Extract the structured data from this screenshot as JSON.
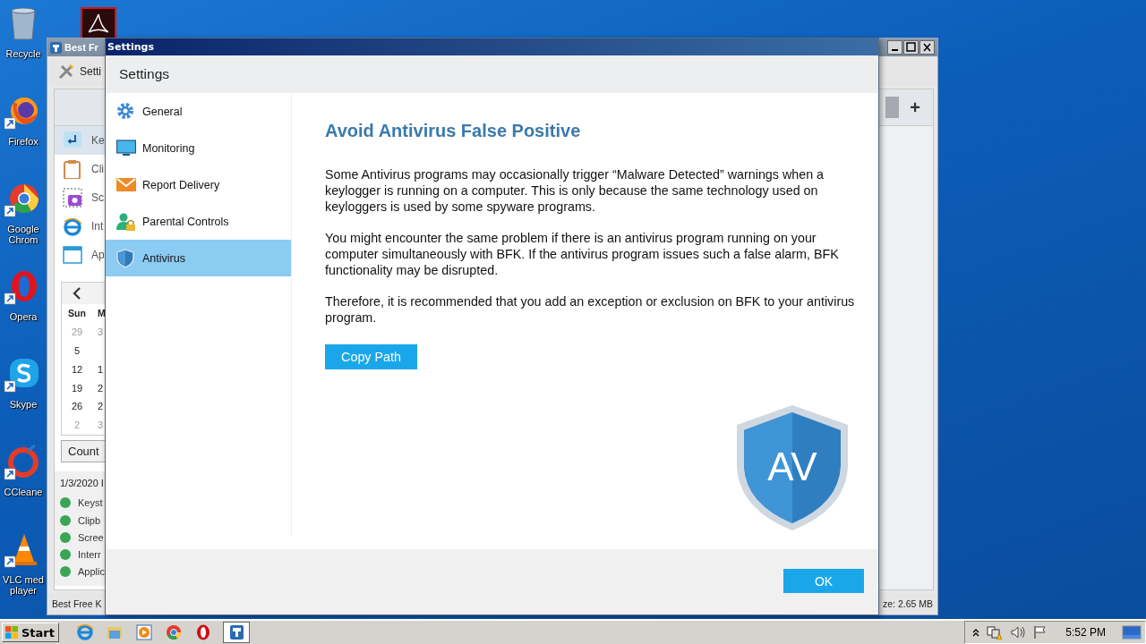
{
  "desktop_icons": [
    {
      "kind": "recycle",
      "label": "Recycle"
    },
    {
      "kind": "firefox",
      "label": "Firefox"
    },
    {
      "kind": "chrome",
      "label": "Google Chrom"
    },
    {
      "kind": "opera",
      "label": "Opera"
    },
    {
      "kind": "skype",
      "label": "Skype"
    },
    {
      "kind": "ccleaner",
      "label": "CCleane"
    },
    {
      "kind": "vlc",
      "label": "VLC med player"
    }
  ],
  "background_window": {
    "title": "Best Fr",
    "toolbar_button": "Setti",
    "sidebar_items": [
      {
        "kind": "keys",
        "label": "Ke",
        "selected": true
      },
      {
        "kind": "clipboard",
        "label": "Cli",
        "selected": false
      },
      {
        "kind": "camera",
        "label": "Sc",
        "selected": false
      },
      {
        "kind": "browser",
        "label": "Int",
        "selected": false
      },
      {
        "kind": "window",
        "label": "Ap",
        "selected": false
      }
    ],
    "calendar": {
      "day_headers": [
        "Sun",
        "M"
      ],
      "weeks": [
        [
          {
            "text": "29",
            "other_month": true
          },
          {
            "text": "3",
            "other_month": true
          }
        ],
        [
          {
            "text": "5",
            "other_month": false
          }
        ],
        [
          {
            "text": "12",
            "other_month": false
          },
          {
            "text": "1",
            "other_month": false
          }
        ],
        [
          {
            "text": "19",
            "other_month": false
          },
          {
            "text": "2",
            "other_month": false
          }
        ],
        [
          {
            "text": "26",
            "other_month": false
          },
          {
            "text": "2",
            "other_month": false
          }
        ],
        [
          {
            "text": "2",
            "other_month": true
          },
          {
            "text": "3",
            "other_month": true
          }
        ]
      ]
    },
    "count_button": "Count",
    "date_label": "1/3/2020 I",
    "log_items": [
      "Keyst",
      "Clipb",
      "Scree",
      "Interr",
      "Applic"
    ],
    "add_button": "+",
    "status_left": "Best Free K",
    "status_right": "ze: 2.65 MB"
  },
  "settings_dialog": {
    "title": "Settings",
    "header": "Settings",
    "nav_items": [
      {
        "kind": "gear",
        "label": "General",
        "selected": false
      },
      {
        "kind": "monitor",
        "label": "Monitoring",
        "selected": false
      },
      {
        "kind": "envelope",
        "label": "Report Delivery",
        "selected": false
      },
      {
        "kind": "person",
        "label": "Parental Controls",
        "selected": false
      },
      {
        "kind": "shield",
        "label": "Antivirus",
        "selected": true
      }
    ],
    "heading": "Avoid Antivirus False Positive",
    "paragraphs": [
      "Some Antivirus programs may occasionally trigger “Malware Detected” warnings when a keylogger is running on a computer. This is only because the same technology used on keyloggers is used by some spyware programs.",
      "You might encounter the same problem if there is an antivirus program running on your computer simultaneously with BFK. If the antivirus program issues such a false alarm, BFK functionality may be disrupted.",
      "Therefore, it is recommended that you add an exception or exclusion on BFK to your antivirus program."
    ],
    "copy_button": "Copy Path",
    "shield_text": "AV",
    "ok_button": "OK"
  },
  "taskbar": {
    "start": "Start",
    "apps": [
      {
        "kind": "ie",
        "active": false
      },
      {
        "kind": "folder",
        "active": false
      },
      {
        "kind": "media",
        "active": false
      },
      {
        "kind": "chrome",
        "active": false
      },
      {
        "kind": "opera",
        "active": false
      },
      {
        "kind": "bfk",
        "active": true
      }
    ],
    "clock": "5:52 PM"
  }
}
